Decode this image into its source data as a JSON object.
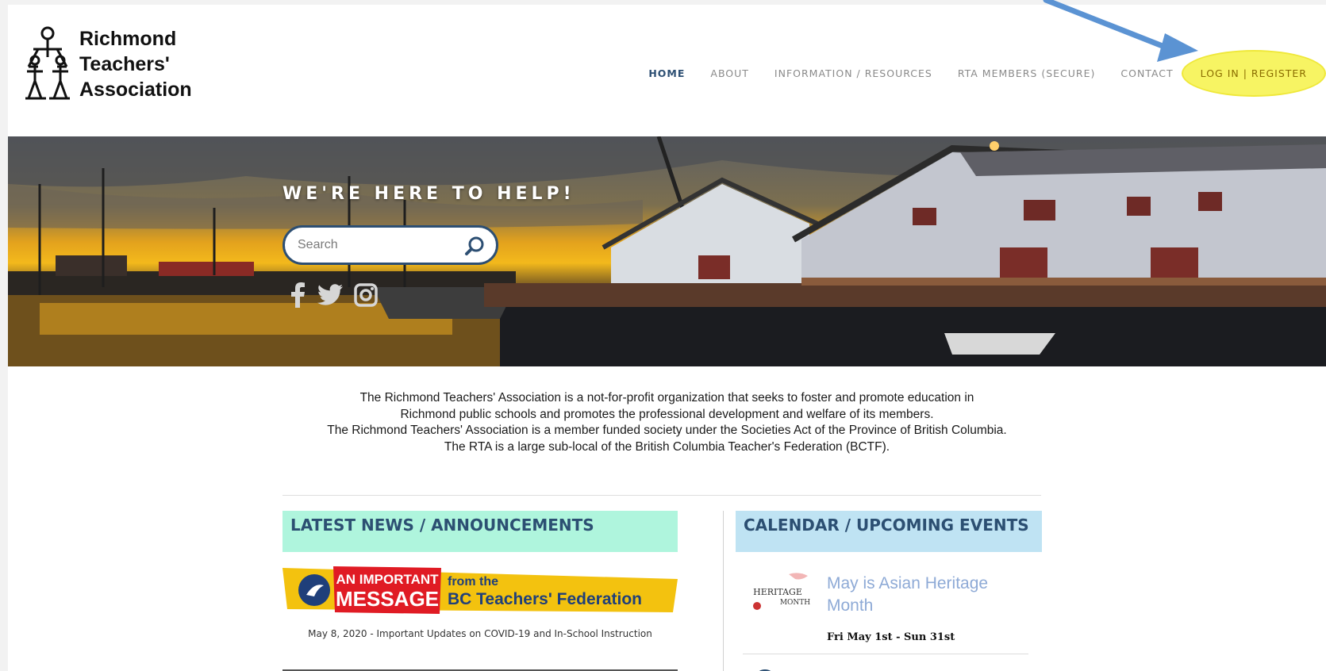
{
  "logo": {
    "line1": "Richmond",
    "line2": "Teachers'",
    "line3": "Association",
    "icon": "people-holding-hands-logo"
  },
  "nav": {
    "items": [
      {
        "label": "HOME",
        "active": true
      },
      {
        "label": "ABOUT"
      },
      {
        "label": "INFORMATION / RESOURCES"
      },
      {
        "label": "RTA MEMBERS (SECURE)"
      },
      {
        "label": "CONTACT"
      },
      {
        "label": "LOG IN | REGISTER",
        "highlighted": true
      }
    ]
  },
  "hero": {
    "title": "WE'RE HERE TO HELP!",
    "search": {
      "placeholder": "Search",
      "icon": "search-icon"
    },
    "social": [
      "facebook-icon",
      "twitter-icon",
      "instagram-icon"
    ]
  },
  "intro": {
    "lines": [
      "The Richmond Teachers' Association is a not-for-profit organization that seeks to foster and promote education in",
      "Richmond public schools and promotes the professional development and welfare of its members.",
      "The Richmond Teachers' Association is a member funded society under the Societies Act of the Province of British Columbia.",
      "The RTA is a large sub-local of the British Columbia Teacher's Federation (BCTF)."
    ]
  },
  "news": {
    "heading": "LATEST NEWS / ANNOUNCEMENTS",
    "banner": {
      "text1": "AN IMPORTANT",
      "text2": "MESSAGE",
      "text3": "from the",
      "text4": "BC Teachers' Federation"
    },
    "caption": "May 8, 2020 - Important Updates on COVID-19 and In-School Instruction"
  },
  "calendar": {
    "heading": "CALENDAR / UPCOMING EVENTS",
    "event": {
      "thumb_text1": "HERITAGE",
      "thumb_text2": "MONTH",
      "title": "May is Asian Heritage Month",
      "date": "Fri May 1st - Sun 31st"
    }
  },
  "colors": {
    "accent": "#2c4f72",
    "news_head_bg": "#aff5dd",
    "calendar_head_bg": "#bfe3f3",
    "highlight": "#f7f463",
    "arrow": "#5b93d3"
  }
}
